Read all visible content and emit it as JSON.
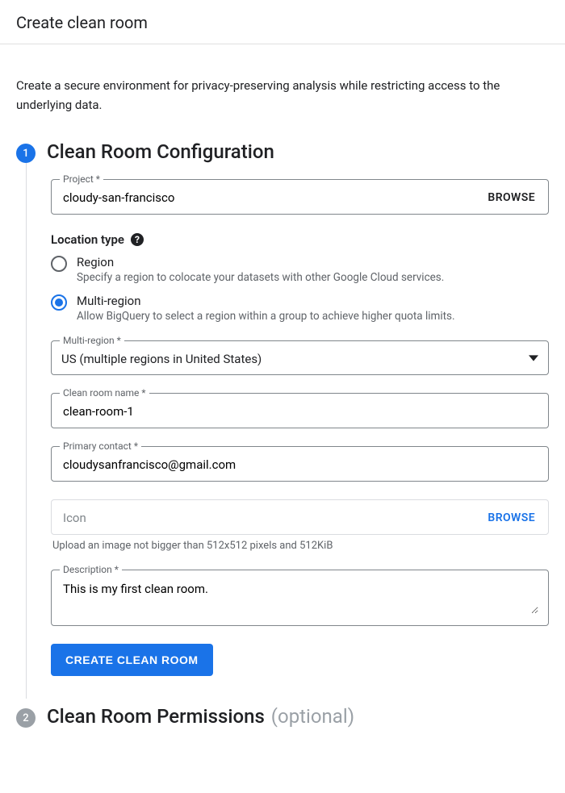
{
  "header": {
    "title": "Create clean room"
  },
  "intro": "Create a secure environment for privacy-preserving analysis while restricting access to the underlying data.",
  "step1": {
    "badge": "1",
    "title": "Clean Room Configuration",
    "project": {
      "label": "Project *",
      "value": "cloudy-san-francisco",
      "browse": "BROWSE"
    },
    "locationType": {
      "label": "Location type",
      "options": {
        "region": {
          "title": "Region",
          "desc": "Specify a region to colocate your datasets with other Google Cloud services."
        },
        "multi": {
          "title": "Multi-region",
          "desc": "Allow BigQuery to select a region within a group to achieve higher quota limits."
        }
      },
      "selected": "multi"
    },
    "multiRegion": {
      "label": "Multi-region *",
      "value": "US (multiple regions in United States)"
    },
    "cleanRoomName": {
      "label": "Clean room name *",
      "value": "clean-room-1"
    },
    "primaryContact": {
      "label": "Primary contact *",
      "value": "cloudysanfrancisco@gmail.com"
    },
    "icon": {
      "placeholder": "Icon",
      "browse": "BROWSE",
      "helper": "Upload an image not bigger than 512x512 pixels and 512KiB"
    },
    "description": {
      "label": "Description *",
      "value": "This is my first clean room."
    },
    "submit": "CREATE CLEAN ROOM"
  },
  "step2": {
    "badge": "2",
    "title": "Clean Room Permissions",
    "optional": "(optional)"
  }
}
